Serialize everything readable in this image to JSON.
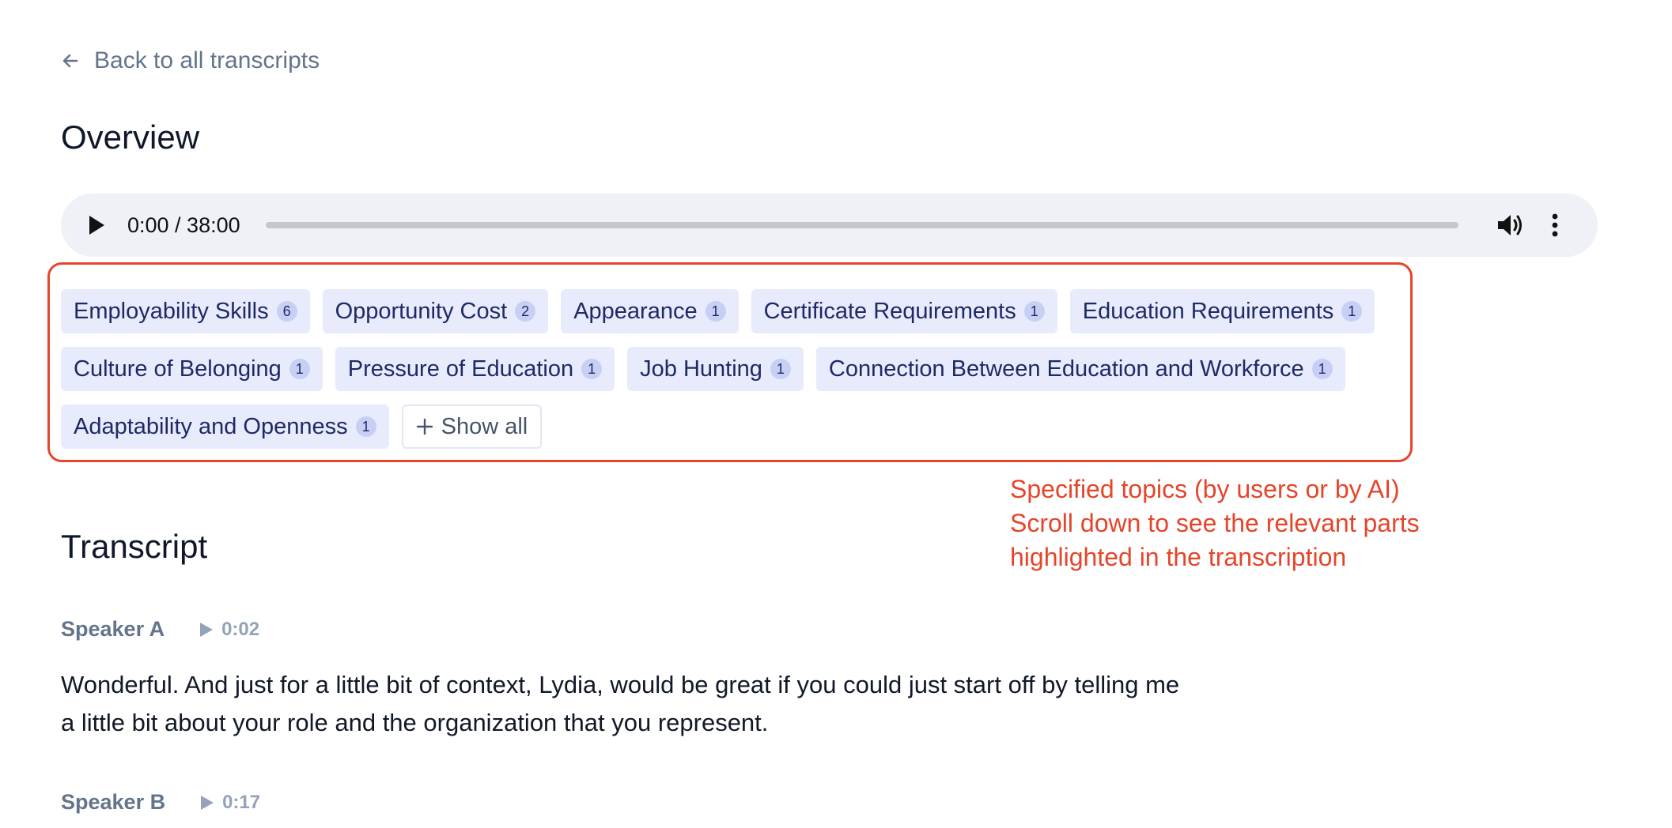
{
  "nav": {
    "back_label": "Back to all transcripts"
  },
  "overview": {
    "title": "Overview"
  },
  "audio": {
    "time_display": "0:00 / 38:00",
    "progress": 0
  },
  "topics": [
    {
      "label": "Employability Skills",
      "count": "6"
    },
    {
      "label": "Opportunity Cost",
      "count": "2"
    },
    {
      "label": "Appearance",
      "count": "1"
    },
    {
      "label": "Certificate Requirements",
      "count": "1"
    },
    {
      "label": "Education Requirements",
      "count": "1"
    },
    {
      "label": "Culture of Belonging",
      "count": "1"
    },
    {
      "label": "Pressure of Education",
      "count": "1"
    },
    {
      "label": "Job Hunting",
      "count": "1"
    },
    {
      "label": "Connection Between Education and Workforce",
      "count": "1"
    },
    {
      "label": "Adaptability and Openness",
      "count": "1"
    }
  ],
  "show_all_label": "Show all",
  "annotation": {
    "lines": [
      "Specified topics (by users or by AI)",
      "Scroll down to see the relevant parts",
      "highlighted in the transcription"
    ],
    "color": "#e5452b"
  },
  "transcript": {
    "title": "Transcript",
    "entries": [
      {
        "speaker": "Speaker A",
        "timestamp": "0:02",
        "text": "Wonderful. And just for a little bit of context, Lydia, would be great if you could just start off by telling me a little bit about your role and the organization that you represent."
      },
      {
        "speaker": "Speaker B",
        "timestamp": "0:17",
        "text": ""
      }
    ]
  },
  "icons": {
    "back": "arrow-left-icon",
    "play": "play-icon",
    "volume": "volume-icon",
    "more": "more-vertical-icon",
    "plus": "plus-icon"
  }
}
